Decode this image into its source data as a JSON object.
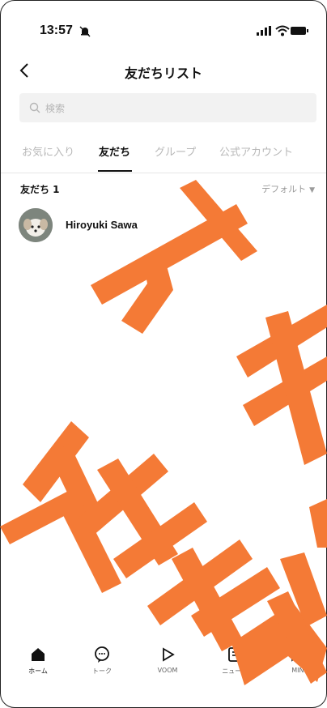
{
  "status_bar": {
    "time": "13:57"
  },
  "header": {
    "title": "友だちリスト"
  },
  "search": {
    "placeholder": "検索"
  },
  "tabs": [
    {
      "label": "お気に入り",
      "active": false
    },
    {
      "label": "友だち",
      "active": true
    },
    {
      "label": "グループ",
      "active": false
    },
    {
      "label": "公式アカウント",
      "active": false
    }
  ],
  "list": {
    "section_title": "友だち 1",
    "sort_label": "デフォルト",
    "items": [
      {
        "name": "Hiroyuki Sawa"
      }
    ]
  },
  "bottom_nav": [
    {
      "label": "ホーム",
      "icon": "home-icon",
      "active": true
    },
    {
      "label": "トーク",
      "icon": "chat-icon",
      "active": false
    },
    {
      "label": "VOOM",
      "icon": "voom-icon",
      "active": false
    },
    {
      "label": "ニュース",
      "icon": "news-icon",
      "active": false
    },
    {
      "label": "MINI",
      "icon": "mini-icon",
      "active": false
    }
  ],
  "watermark": {
    "text": "テキスト株式",
    "color": "#F47A36"
  }
}
